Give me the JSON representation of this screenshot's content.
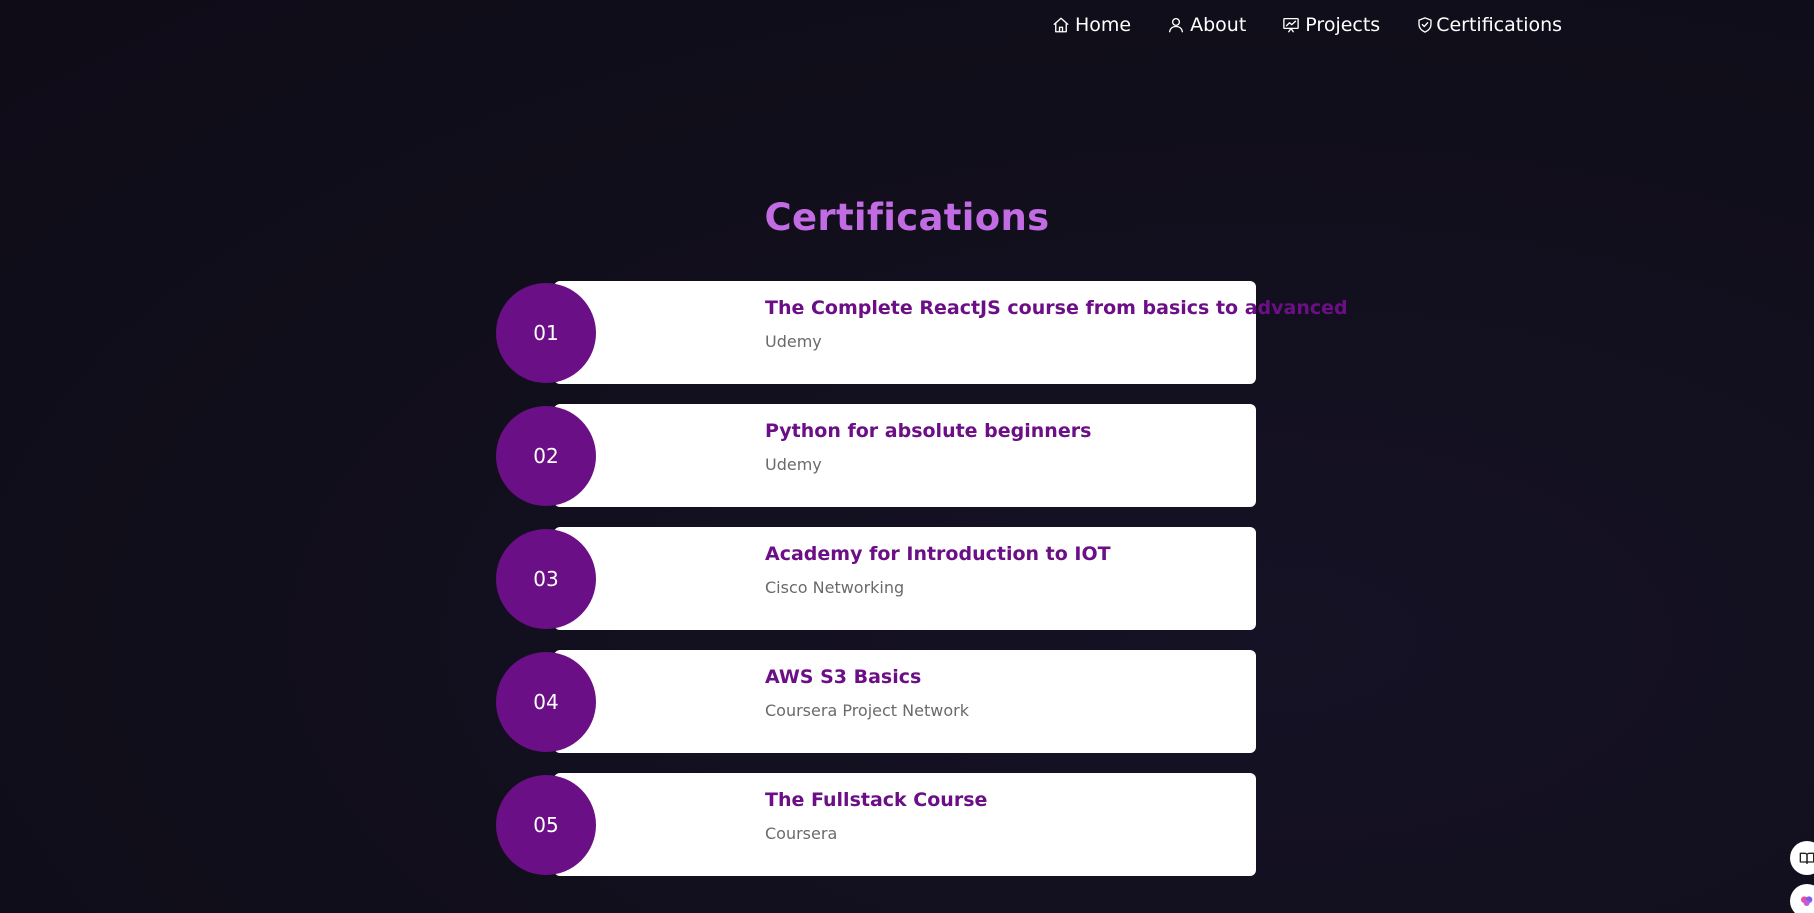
{
  "nav": {
    "items": [
      {
        "label": "Home",
        "icon": "home-icon"
      },
      {
        "label": "About",
        "icon": "user-icon"
      },
      {
        "label": "Projects",
        "icon": "presentation-icon"
      },
      {
        "label": "Certifications",
        "icon": "shield-check-icon"
      }
    ]
  },
  "section": {
    "title": "Certifications"
  },
  "certifications": [
    {
      "number": "01",
      "title": "The Complete ReactJS course from basics to advanced",
      "issuer": "Udemy"
    },
    {
      "number": "02",
      "title": "Python for absolute beginners",
      "issuer": "Udemy"
    },
    {
      "number": "03",
      "title": "Academy for Introduction to IOT",
      "issuer": "Cisco Networking"
    },
    {
      "number": "04",
      "title": "AWS S3 Basics",
      "issuer": "Coursera Project Network"
    },
    {
      "number": "05",
      "title": "The Fullstack Course",
      "issuer": "Coursera"
    }
  ],
  "side_buttons": [
    {
      "icon": "book-open-icon"
    },
    {
      "icon": "brain-icon"
    }
  ],
  "colors": {
    "background": "#110e1b",
    "accent_title": "#c26ce4",
    "badge": "#6a0f86",
    "card_title": "#6c0f86",
    "card_subtitle": "#6a6a6a"
  }
}
